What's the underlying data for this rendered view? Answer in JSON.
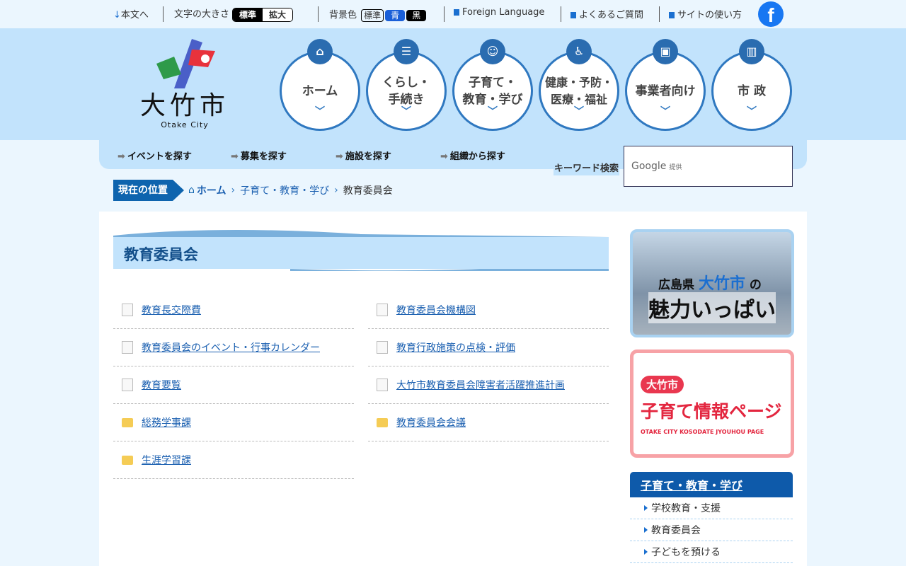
{
  "topbar": {
    "skip": "本文へ",
    "font_size_label": "文字の大きさ",
    "font_std": "標準",
    "font_large": "拡大",
    "bg_label": "背景色",
    "bg_std": "標準",
    "bg_blue": "青",
    "bg_black": "黒",
    "foreign": "Foreign Language",
    "faq": "よくあるご質問",
    "usage": "サイトの使い方",
    "facebook": "f"
  },
  "logo": {
    "name": "大竹市",
    "en": "Otake City"
  },
  "nav": [
    {
      "label": "ホーム",
      "icon": "home"
    },
    {
      "label": "くらし・\n手続き",
      "icon": "document"
    },
    {
      "label": "子育て・\n教育・学び",
      "icon": "child"
    },
    {
      "label": "健康・予防・\n医療・福祉",
      "icon": "wheelchair"
    },
    {
      "label": "事業者向け",
      "icon": "briefcase"
    },
    {
      "label": "市 政",
      "icon": "building"
    }
  ],
  "subnav": [
    "イベントを探す",
    "募集を探す",
    "施設を探す",
    "組織から探す"
  ],
  "search": {
    "label": "キーワード検索",
    "brand": "Google",
    "provided": "提供"
  },
  "breadcrumb": {
    "here": "現在の位置",
    "items": [
      "ホーム",
      "子育て・教育・学び"
    ],
    "current": "教育委員会"
  },
  "page": {
    "title": "教育委員会"
  },
  "links": [
    {
      "label": "教育長交際費",
      "type": "page"
    },
    {
      "label": "教育委員会機構図",
      "type": "page"
    },
    {
      "label": "教育委員会のイベント・行事カレンダー",
      "type": "page"
    },
    {
      "label": "教育行政施策の点検・評価",
      "type": "page"
    },
    {
      "label": "教育要覧",
      "type": "page"
    },
    {
      "label": "大竹市教育委員会障害者活躍推進計画",
      "type": "page"
    },
    {
      "label": "総務学事課",
      "type": "folder"
    },
    {
      "label": "教育委員会会議",
      "type": "folder"
    },
    {
      "label": "生涯学習課",
      "type": "folder"
    }
  ],
  "banners": {
    "b1_pre": "広島県",
    "b1_city": "大竹市",
    "b1_post": "の",
    "b1_main": "魅力いっぱい",
    "b2_city": "大竹市",
    "b2_main": "子育て情報ページ",
    "b2_en": "OTAKE CITY KOSODATE JYOUHOU PAGE"
  },
  "sidebar": {
    "heading": "子育て・教育・学び",
    "items": [
      "学校教育・支援",
      "教育委員会",
      "子どもを預ける"
    ]
  }
}
